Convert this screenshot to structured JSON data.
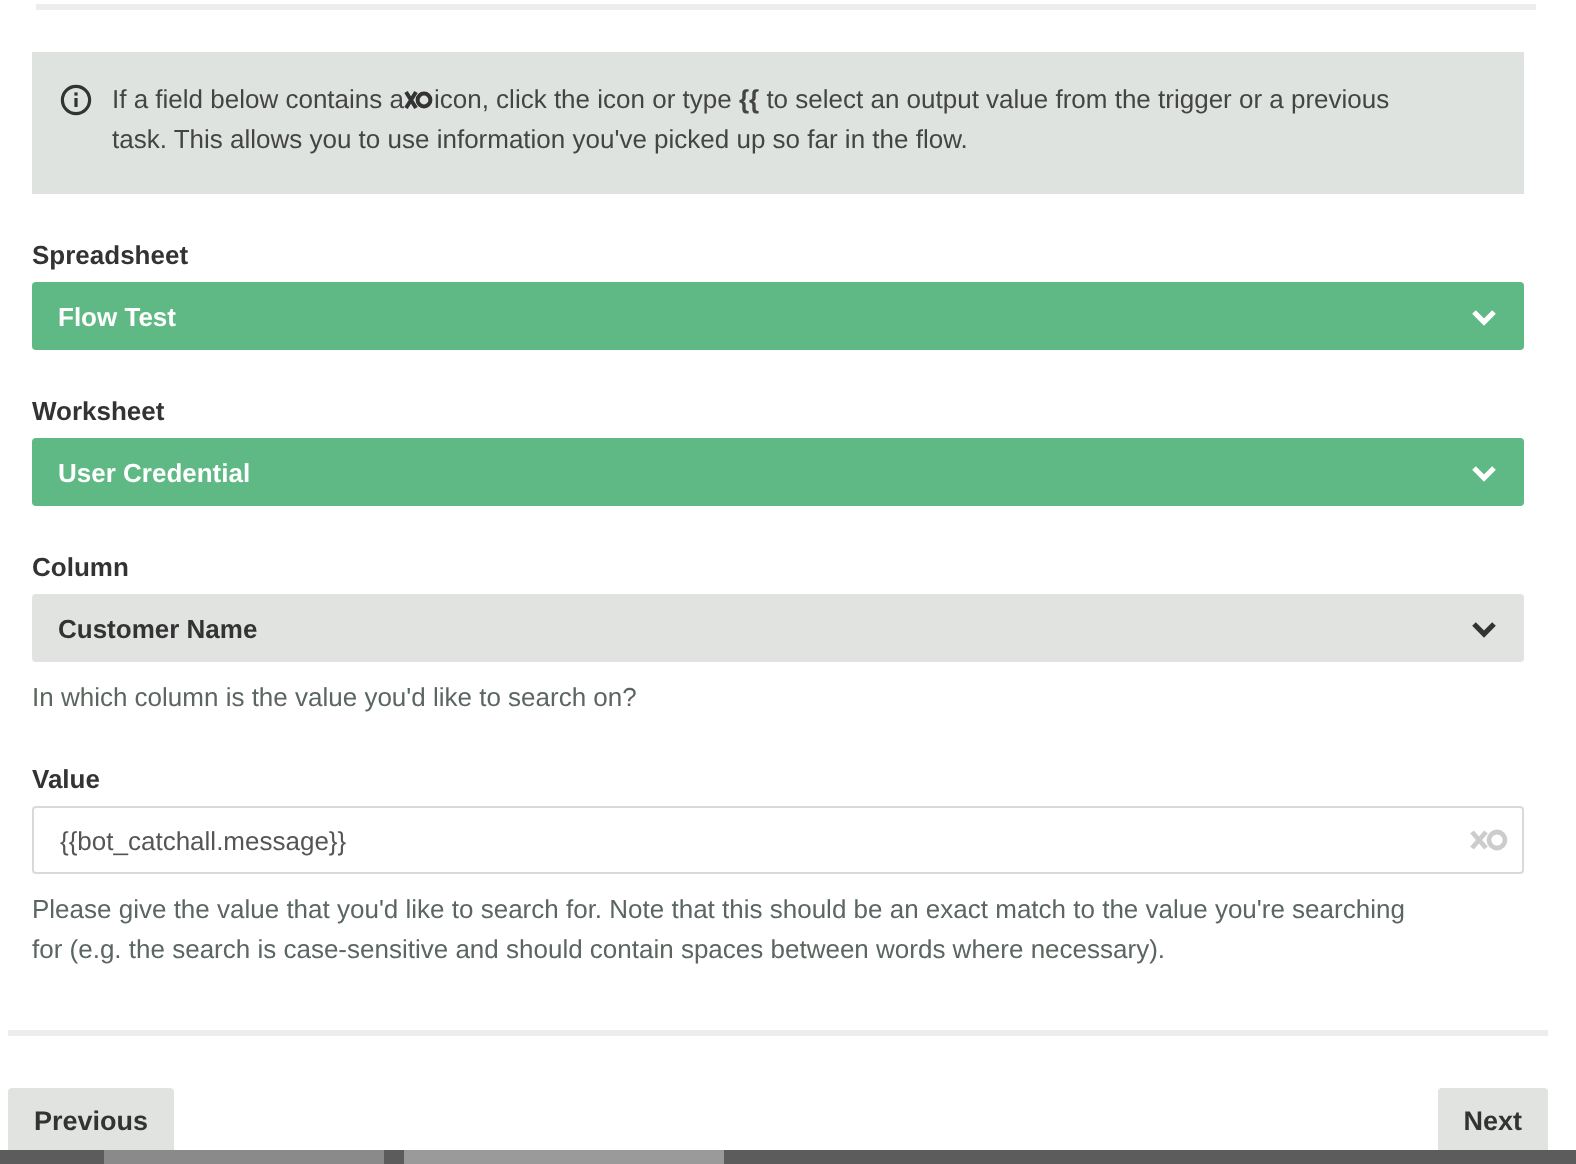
{
  "info": {
    "text_before_icon": "If a field below contains a",
    "text_after_icon": "icon, click the icon or type **{{** to select an output value from the trigger or a previous task. This allows you to use information you've picked up so far in the flow."
  },
  "fields": [
    {
      "kind": "select",
      "label": "Spreadsheet",
      "value": "Flow Test",
      "highlighted": true
    },
    {
      "kind": "select",
      "label": "Worksheet",
      "value": "User Credential",
      "highlighted": true
    },
    {
      "kind": "select",
      "label": "Column",
      "value": "Customer Name",
      "highlighted": false,
      "help": "In which column is the value you'd like to search on?"
    },
    {
      "kind": "text",
      "label": "Value",
      "value": "{{bot_catchall.message}}",
      "help": "Please give the value that you'd like to search for. Note that this should be an exact match to the value you're searching for (e.g. the search is case-sensitive and should contain spaces between words where necessary)."
    }
  ],
  "buttons": {
    "previous": "Previous",
    "next": "Next"
  }
}
